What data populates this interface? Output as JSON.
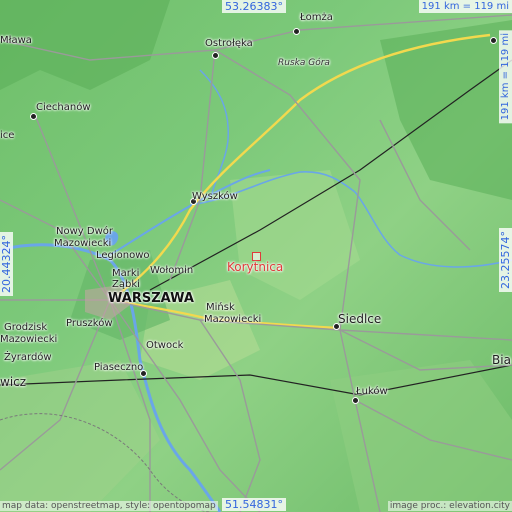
{
  "map": {
    "target_name": "Korytnica",
    "coords": {
      "top_lat": "53.26383°",
      "bottom_lat": "51.54831°",
      "left_lon": "20.44324°",
      "right_lon": "23.25574°"
    },
    "scale": {
      "horizontal": "191 km = 119 mi",
      "vertical": "191 km = 119 mi"
    },
    "attribution_left": "map data: openstreetmap, style: opentopomap",
    "attribution_right": "image proc.: elevation.city",
    "places": {
      "lomza": "Łomża",
      "ostroleka": "Ostrołęka",
      "ruska_gora": "Ruska Góra",
      "mlawa": "Mława",
      "ciechanow": "Ciechanów",
      "wyszkow": "Wyszków",
      "nowy_dwor_1": "Nowy Dwór",
      "nowy_dwor_2": "Mazowiecki",
      "legionowo": "Legionowo",
      "marki": "Marki",
      "wolomin": "Wołomin",
      "zabki": "Ząbki",
      "warszawa": "WARSZAWA",
      "minsk_1": "Mińsk",
      "minsk_2": "Mazowiecki",
      "siedlce": "Siedlce",
      "grodzisk_1": "Grodzisk",
      "grodzisk_2": "Mazowiecki",
      "pruszkow": "Pruszków",
      "zyrardow": "Żyrardów",
      "otwock": "Otwock",
      "piaseczno": "Piaseczno",
      "lukow": "Łuków",
      "lowicz_partial": "wicz",
      "biala_partial": "Bia",
      "plonsk_partial": "ice"
    }
  }
}
